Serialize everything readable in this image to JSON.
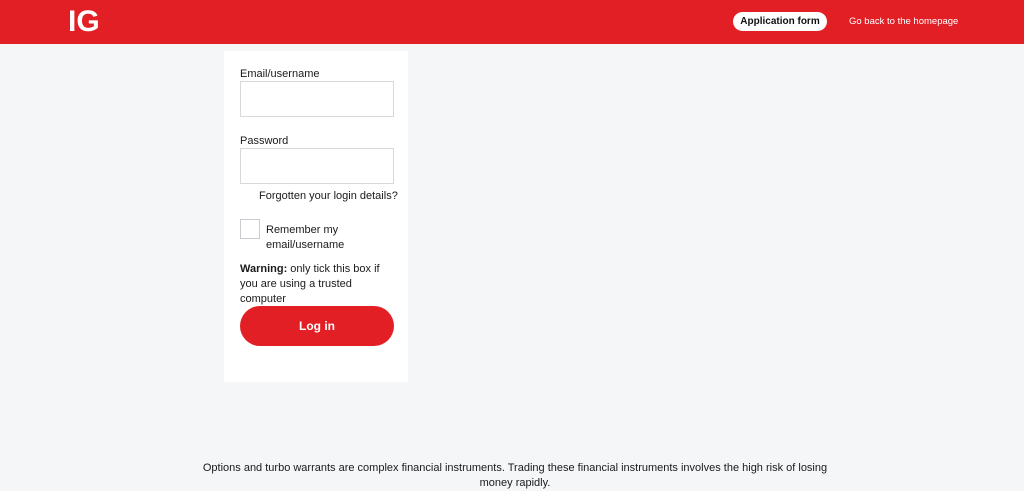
{
  "header": {
    "logo_text": "IG",
    "application_form_label": "Application form",
    "homepage_link_label": "Go back to the homepage"
  },
  "login_form": {
    "email_label": "Email/username",
    "email_value": "",
    "password_label": "Password",
    "password_value": "",
    "forgot_link": "Forgotten your login details?",
    "remember_label": "Remember my email/username",
    "remember_checked": false,
    "warning_bold": "Warning:",
    "warning_text": " only tick this box if you are using a trusted computer",
    "login_button": "Log in"
  },
  "footer": {
    "disclaimer": "Options and turbo warrants are complex financial instruments. Trading these financial instruments involves the high risk of losing money rapidly."
  },
  "colors": {
    "brand_red": "#e31f26",
    "page_background": "#f4f6f8",
    "card_background": "#ffffff"
  }
}
